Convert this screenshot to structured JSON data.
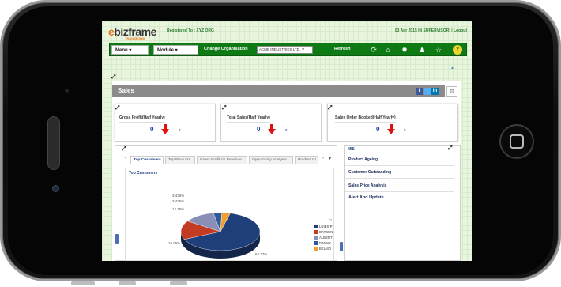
{
  "header": {
    "logo_text": "ebizframe",
    "logo_subtext": "TRANSFORM",
    "registered": "Registered To :  XYZ ORG",
    "date_user": "03 Apr 2015   Hi SUPERVISOR!  |  Logout"
  },
  "nav": {
    "menu_label": "Menu ▾",
    "module_label": "Module ▾",
    "change_org_label": "Change Organisation",
    "org_value": "ACME INDUSTRIES LTD.  ▼",
    "refresh_label": "Refresh"
  },
  "sales": {
    "title": "Sales",
    "social": [
      "f",
      "t",
      "in"
    ]
  },
  "kpis": [
    {
      "title": "Gross Profit(Half Yearly)",
      "value": "0",
      "small": "0"
    },
    {
      "title": "Total Sales(Half Yearly)",
      "value": "0",
      "small": "0"
    },
    {
      "title": "Sales Order Booked(Half Yearly)",
      "value": "0",
      "small": "0"
    }
  ],
  "tabs": [
    "Top Customers",
    "Top Products",
    "Gross Profit Vs Revenue",
    "Opportunity Analysis",
    "Product Gr"
  ],
  "chart_data": {
    "type": "pie",
    "title": "Top Customers",
    "slices": [
      {
        "label": "LUIES P",
        "value": 64.37,
        "color": "#1f3f7a"
      },
      {
        "label": "DATSUN",
        "value": 16.06,
        "color": "#c23b22"
      },
      {
        "label": "ALBERT",
        "value": 12.75,
        "color": "#8a8fb8"
      },
      {
        "label": "DANNY",
        "value": 3.435,
        "color": "#2c5c9e"
      },
      {
        "label": "BELMO",
        "value": 3.436,
        "color": "#f0a030"
      }
    ],
    "labels": [
      "3.436%",
      "3.435%",
      "12.75%",
      "16.06%",
      "64.37%"
    ],
    "legend_title": "Cu"
  },
  "mis": {
    "title": "MIS",
    "items": [
      "Product Ageing",
      "Customer Outstanding",
      "Sales Price Analysis",
      "Alert And Update"
    ]
  }
}
